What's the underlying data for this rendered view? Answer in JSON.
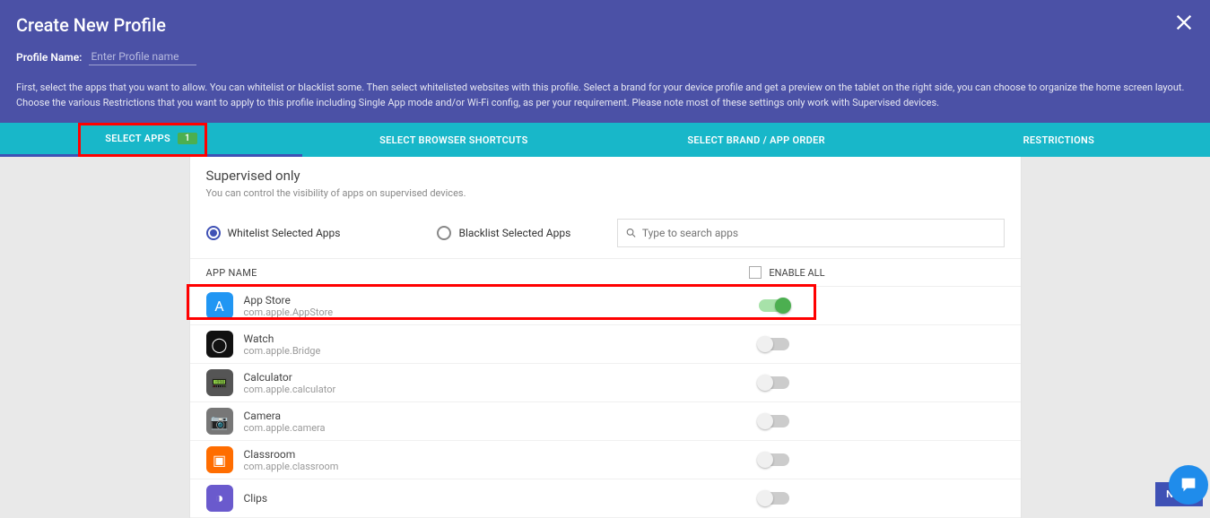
{
  "header": {
    "title": "Create New Profile",
    "profile_name_label": "Profile Name:",
    "profile_name_placeholder": "Enter Profile name",
    "description": "First, select the apps that you want to allow. You can whitelist or blacklist some. Then select whitelisted websites with this profile. Select a brand for your device profile and get a preview on the tablet on the right side, you can choose to organize the home screen layout. Choose the various Restrictions that you want to apply to this profile including Single App mode and/or Wi-Fi config, as per your requirement. Please note most of these settings only work with Supervised devices."
  },
  "tabs": {
    "items": [
      {
        "label": "SELECT APPS",
        "badge": "1",
        "active": true
      },
      {
        "label": "SELECT BROWSER SHORTCUTS"
      },
      {
        "label": "SELECT BRAND / APP ORDER"
      },
      {
        "label": "RESTRICTIONS"
      }
    ]
  },
  "panel": {
    "title": "Supervised only",
    "subtitle": "You can control the visibility of apps on supervised devices.",
    "radio_whitelist": "Whitelist Selected Apps",
    "radio_blacklist": "Blacklist Selected Apps",
    "search_placeholder": "Type to search apps",
    "th_app_name": "APP NAME",
    "enable_all_label": "ENABLE ALL"
  },
  "apps": [
    {
      "name": "App Store",
      "pkg": "com.apple.AppStore",
      "enabled": true,
      "icon_class": "ic-appstore",
      "glyph": "A"
    },
    {
      "name": "Watch",
      "pkg": "com.apple.Bridge",
      "enabled": false,
      "icon_class": "ic-watch",
      "glyph": "◯"
    },
    {
      "name": "Calculator",
      "pkg": "com.apple.calculator",
      "enabled": false,
      "icon_class": "ic-calc",
      "glyph": "📟"
    },
    {
      "name": "Camera",
      "pkg": "com.apple.camera",
      "enabled": false,
      "icon_class": "ic-camera",
      "glyph": "📷"
    },
    {
      "name": "Classroom",
      "pkg": "com.apple.classroom",
      "enabled": false,
      "icon_class": "ic-class",
      "glyph": "▣"
    },
    {
      "name": "Clips",
      "pkg": "",
      "enabled": false,
      "icon_class": "ic-clips",
      "glyph": "◑"
    }
  ],
  "footer": {
    "next_label": "NEXT"
  }
}
